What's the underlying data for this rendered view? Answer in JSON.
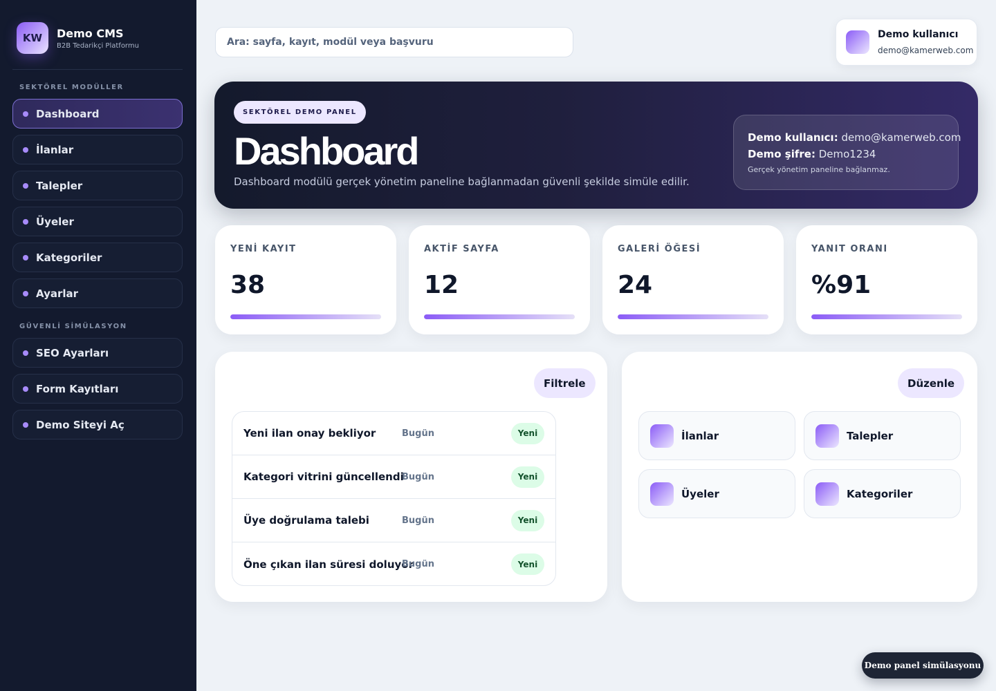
{
  "brand": {
    "logo_text": "KW",
    "name": "Demo CMS",
    "subtitle": "B2B Tedarikçi Platformu"
  },
  "sidebar": {
    "section1_title": "SEKTÖREL MODÜLLER",
    "section2_title": "GÜVENLİ SİMÜLASYON",
    "items": [
      {
        "label": "Dashboard",
        "active": true
      },
      {
        "label": "İlanlar"
      },
      {
        "label": "Talepler"
      },
      {
        "label": "Üyeler"
      },
      {
        "label": "Kategoriler"
      },
      {
        "label": "Ayarlar"
      },
      {
        "label": "SEO Ayarları"
      },
      {
        "label": "Form Kayıtları"
      },
      {
        "label": "Demo Siteyi Aç"
      }
    ]
  },
  "search": {
    "placeholder": "Ara: sayfa, kayıt, modül veya başvuru"
  },
  "user": {
    "name": "Demo kullanıcı",
    "email": "demo@kamerweb.com"
  },
  "hero": {
    "badge": "SEKTÖREL DEMO PANEL",
    "title": "Dashboard",
    "description": "Dashboard modülü gerçek yönetim paneline bağlanmadan güvenli şekilde simüle edilir.",
    "info_user_label": "Demo kullanıcı:",
    "info_user_value": "demo@kamerweb.com",
    "info_pass_label": "Demo şifre:",
    "info_pass_value": "Demo1234",
    "info_note": "Gerçek yönetim paneline bağlanmaz."
  },
  "stats": [
    {
      "label": "YENİ KAYIT",
      "value": "38",
      "progress": 1.0
    },
    {
      "label": "AKTİF SAYFA",
      "value": "12",
      "progress": 1.0
    },
    {
      "label": "GALERİ ÖĞESİ",
      "value": "24",
      "progress": 1.0
    },
    {
      "label": "YANIT ORANI",
      "value": "%91",
      "progress": 1.0
    }
  ],
  "activity": {
    "button": "Filtrele",
    "rows": [
      {
        "title": "Yeni ilan onay bekliyor",
        "date": "Bugün",
        "badge": "Yeni"
      },
      {
        "title": "Kategori vitrini güncellendi",
        "date": "Bugün",
        "badge": "Yeni"
      },
      {
        "title": "Üye doğrulama talebi",
        "date": "Bugün",
        "badge": "Yeni"
      },
      {
        "title": "Öne çıkan ilan süresi doluyor",
        "date": "Bugün",
        "badge": "Yeni"
      }
    ]
  },
  "shortcuts": {
    "button": "Düzenle",
    "tiles": [
      {
        "label": "İlanlar"
      },
      {
        "label": "Talepler"
      },
      {
        "label": "Üyeler"
      },
      {
        "label": "Kategoriler"
      }
    ]
  },
  "footer_badge": "Demo panel simülasyonu",
  "colors": {
    "accent": "#8b5cf6",
    "sidebar_bg": "#131a2e",
    "page_bg": "#eef2f7",
    "badge_green": "#dcfce7"
  }
}
